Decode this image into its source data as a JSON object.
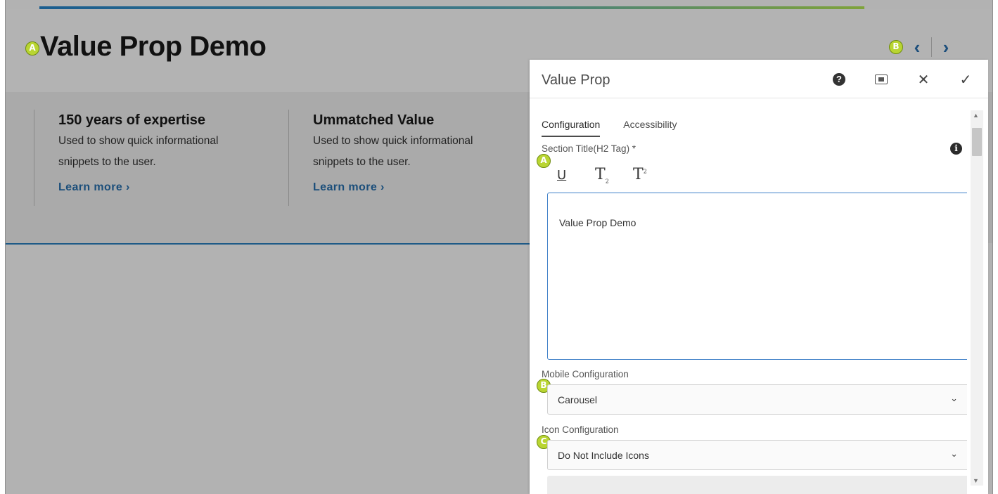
{
  "page": {
    "title": "Value Prop Demo",
    "title_marker": "A",
    "nav_marker": "B",
    "nav_prev_icon": "‹",
    "nav_next_icon": "›",
    "cards": [
      {
        "title": "150 years of expertise",
        "description": "Used to show quick informational snippets to the user.",
        "link": "Learn more ›"
      },
      {
        "title": "Ummatched Value",
        "description": "Used to show quick informational snippets to the user.",
        "link": "Learn more ›"
      }
    ]
  },
  "dialog": {
    "title": "Value Prop",
    "help_icon": "?",
    "close_icon": "✕",
    "confirm_icon": "✓",
    "tabs": [
      {
        "label": "Configuration",
        "active": true
      },
      {
        "label": "Accessibility",
        "active": false
      }
    ],
    "section_title_label": "Section Title(H2 Tag) *",
    "info_icon": "i",
    "rte": {
      "underline": "U",
      "subscript": "T",
      "subscript_mark": "2",
      "superscript": "T",
      "superscript_mark": "2",
      "value": "Value Prop Demo"
    },
    "markers": {
      "section_title": "A",
      "mobile": "B",
      "icon": "C"
    },
    "mobile_config": {
      "label": "Mobile Configuration",
      "value": "Carousel"
    },
    "icon_config": {
      "label": "Icon Configuration",
      "value": "Do Not Include Icons"
    },
    "chevron": "⌄"
  },
  "colors": {
    "marker": "#b9d532",
    "link": "#1b4e7a",
    "focus_border": "#3f80c8"
  }
}
